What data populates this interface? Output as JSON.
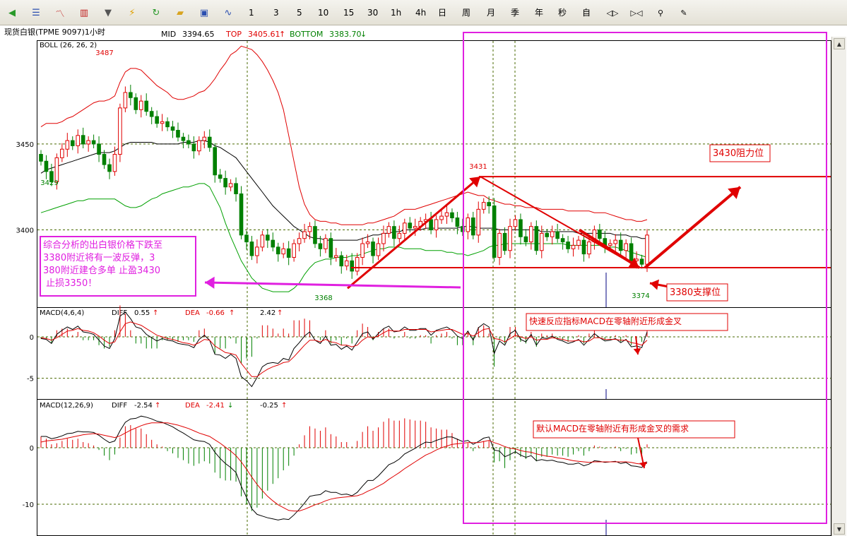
{
  "toolbar": {
    "icons": [
      {
        "name": "back-icon",
        "glyph": "◀",
        "color": "#2a9a2a"
      },
      {
        "name": "list-icon",
        "glyph": "☰",
        "color": "#2b4fb0"
      },
      {
        "name": "line-chart-icon",
        "glyph": "〽",
        "color": "#c02020"
      },
      {
        "name": "kline-icon",
        "glyph": "▥",
        "color": "#c02020"
      },
      {
        "name": "dropdown-icon",
        "glyph": "▼",
        "color": "#555555"
      },
      {
        "name": "lightning-icon",
        "glyph": "⚡",
        "color": "#e0a000"
      },
      {
        "name": "refresh-icon",
        "glyph": "↻",
        "color": "#2a9a2a"
      },
      {
        "name": "folder-icon",
        "glyph": "▰",
        "color": "#d8a420"
      },
      {
        "name": "save-icon",
        "glyph": "▣",
        "color": "#2b4fb0"
      },
      {
        "name": "wave-icon",
        "glyph": "∿",
        "color": "#2b4fb0"
      }
    ],
    "periods": [
      "1",
      "3",
      "5",
      "10",
      "15",
      "30",
      "1h",
      "4h",
      "日",
      "周",
      "月",
      "季",
      "年",
      "秒",
      "自"
    ],
    "tools": [
      {
        "name": "expand-icon",
        "glyph": "◁▷"
      },
      {
        "name": "collapse-icon",
        "glyph": "▷◁"
      },
      {
        "name": "zoom-icon",
        "glyph": "⚲"
      },
      {
        "name": "pen-icon",
        "glyph": "✎"
      }
    ]
  },
  "header": {
    "symbol": "现货白银(TPME 9097)1小时",
    "mid_label": "MID",
    "mid_value": "3394.65",
    "top_label": "TOP",
    "top_value": "3405.61",
    "bottom_label": "BOTTOM",
    "bottom_value": "3383.70",
    "up_arrow": "↑",
    "down_arrow": "↓"
  },
  "colors": {
    "up": "#e00000",
    "down": "#008000",
    "mid_line": "#000000",
    "upper_band": "#e00000",
    "lower_band": "#00a000",
    "annotation": "#e00000",
    "highlight": "#e020e0",
    "grid": "#4a6a00",
    "axis": "#000000"
  },
  "chart_data": [
    {
      "type": "candlestick",
      "indicator": "BOLL (26, 26, 2)",
      "ylim": [
        3355,
        3510
      ],
      "yticks": [
        3400,
        3450
      ],
      "labels": {
        "high": "3487",
        "start_low": "3429",
        "low": "3368",
        "swing_high": "3431",
        "last_low": "3374"
      },
      "closes": [
        3440,
        3434,
        3428,
        3442,
        3447,
        3452,
        3449,
        3455,
        3450,
        3452,
        3450,
        3444,
        3438,
        3434,
        3444,
        3471,
        3480,
        3477,
        3470,
        3475,
        3469,
        3466,
        3462,
        3463,
        3460,
        3458,
        3454,
        3452,
        3450,
        3446,
        3452,
        3454,
        3448,
        3432,
        3430,
        3425,
        3427,
        3421,
        3397,
        3393,
        3385,
        3390,
        3397,
        3394,
        3390,
        3386,
        3389,
        3384,
        3392,
        3395,
        3399,
        3402,
        3392,
        3389,
        3395,
        3384,
        3385,
        3379,
        3382,
        3376,
        3384,
        3392,
        3393,
        3385,
        3392,
        3398,
        3402,
        3395,
        3398,
        3404,
        3401,
        3402,
        3405,
        3406,
        3400,
        3406,
        3408,
        3410,
        3407,
        3402,
        3399,
        3407,
        3397,
        3412,
        3416,
        3414,
        3384,
        3398,
        3388,
        3402,
        3406,
        3396,
        3393,
        3402,
        3388,
        3398,
        3396,
        3399,
        3395,
        3393,
        3389,
        3391,
        3394,
        3386,
        3393,
        3400,
        3395,
        3391,
        3392,
        3394,
        3388,
        3392,
        3382,
        3383,
        3380,
        3397
      ],
      "upper_band": [
        3460,
        3462,
        3462,
        3462,
        3463,
        3465,
        3466,
        3468,
        3470,
        3472,
        3474,
        3475,
        3475,
        3476,
        3478,
        3486,
        3492,
        3494,
        3494,
        3493,
        3490,
        3487,
        3484,
        3482,
        3480,
        3477,
        3476,
        3476,
        3477,
        3478,
        3480,
        3481,
        3484,
        3488,
        3493,
        3497,
        3502,
        3504,
        3507,
        3506,
        3505,
        3502,
        3498,
        3493,
        3487,
        3480,
        3470,
        3455,
        3440,
        3425,
        3415,
        3409,
        3406,
        3405,
        3405,
        3404,
        3404,
        3403,
        3403,
        3403,
        3403,
        3403,
        3404,
        3404,
        3405,
        3406,
        3407,
        3408,
        3410,
        3412,
        3412,
        3412,
        3413,
        3414,
        3415,
        3416,
        3417,
        3418,
        3419,
        3420,
        3421,
        3422,
        3421,
        3420,
        3420,
        3418,
        3417,
        3416,
        3415,
        3415,
        3414,
        3414,
        3413,
        3413,
        3413,
        3412,
        3412,
        3412,
        3412,
        3412,
        3411,
        3411,
        3411,
        3411,
        3411,
        3410,
        3410,
        3410,
        3409,
        3408,
        3407,
        3406,
        3406,
        3405,
        3405,
        3406
      ],
      "mid_line": [
        3433,
        3435,
        3436,
        3437,
        3438,
        3439,
        3440,
        3441,
        3442,
        3443,
        3444,
        3445,
        3445,
        3445,
        3446,
        3448,
        3450,
        3451,
        3451,
        3451,
        3451,
        3451,
        3450,
        3450,
        3450,
        3450,
        3450,
        3451,
        3451,
        3451,
        3452,
        3452,
        3451,
        3449,
        3448,
        3446,
        3444,
        3442,
        3438,
        3434,
        3430,
        3426,
        3422,
        3418,
        3414,
        3411,
        3408,
        3405,
        3402,
        3400,
        3398,
        3396,
        3395,
        3395,
        3394,
        3394,
        3394,
        3394,
        3394,
        3394,
        3394,
        3395,
        3396,
        3397,
        3397,
        3398,
        3398,
        3399,
        3399,
        3400,
        3400,
        3400,
        3400,
        3401,
        3401,
        3401,
        3401,
        3401,
        3401,
        3401,
        3402,
        3402,
        3402,
        3401,
        3401,
        3401,
        3401,
        3400,
        3400,
        3400,
        3400,
        3400,
        3400,
        3400,
        3400,
        3399,
        3399,
        3399,
        3399,
        3399,
        3399,
        3399,
        3398,
        3398,
        3398,
        3398,
        3398,
        3398,
        3398,
        3397,
        3397,
        3397,
        3396,
        3396,
        3395,
        3395
      ],
      "lower_band": [
        3410,
        3411,
        3412,
        3413,
        3414,
        3415,
        3416,
        3417,
        3417,
        3418,
        3418,
        3418,
        3418,
        3418,
        3418,
        3416,
        3414,
        3413,
        3413,
        3414,
        3416,
        3418,
        3419,
        3421,
        3422,
        3423,
        3424,
        3425,
        3425,
        3426,
        3427,
        3427,
        3425,
        3419,
        3413,
        3404,
        3396,
        3389,
        3382,
        3377,
        3372,
        3369,
        3366,
        3365,
        3364,
        3364,
        3364,
        3364,
        3366,
        3369,
        3374,
        3378,
        3381,
        3382,
        3383,
        3383,
        3384,
        3384,
        3384,
        3385,
        3385,
        3386,
        3387,
        3388,
        3389,
        3389,
        3390,
        3390,
        3390,
        3389,
        3389,
        3389,
        3389,
        3388,
        3388,
        3388,
        3388,
        3387,
        3387,
        3386,
        3386,
        3385,
        3386,
        3387,
        3388,
        3390,
        3391,
        3391,
        3392,
        3392,
        3392,
        3392,
        3392,
        3392,
        3392,
        3392,
        3392,
        3392,
        3392,
        3392,
        3391,
        3391,
        3391,
        3391,
        3391,
        3391,
        3391,
        3390,
        3390,
        3390,
        3389,
        3388,
        3387,
        3386,
        3385,
        3384
      ]
    },
    {
      "type": "macd",
      "params": "MACD(4,6,4)",
      "diff_label": "DIFF",
      "diff_value": "0.55",
      "dea_label": "DEA",
      "dea_value": "-0.66",
      "macd_value": "2.42",
      "ylim": [
        -7.5,
        3.5
      ],
      "yticks": [
        0,
        -5
      ],
      "diff": [
        -0.2,
        -0.3,
        -0.8,
        0.3,
        0.8,
        1.2,
        0.9,
        1.3,
        0.6,
        0.5,
        0.3,
        -0.4,
        -1.1,
        -1.4,
        -0.2,
        2.5,
        3.0,
        2.2,
        1.2,
        1.0,
        0.3,
        -0.1,
        -0.5,
        -0.2,
        -0.4,
        -0.5,
        -0.8,
        -0.9,
        -1.0,
        -1.3,
        -0.3,
        0.2,
        -0.4,
        -2.1,
        -2.2,
        -2.6,
        -2.1,
        -2.6,
        -4.8,
        -5.3,
        -6.0,
        -4.9,
        -3.6,
        -3.2,
        -3.1,
        -3.2,
        -2.6,
        -2.8,
        -1.4,
        -0.7,
        0.1,
        0.6,
        -0.4,
        -0.8,
        0.1,
        -1.0,
        -0.9,
        -1.5,
        -1.1,
        -1.6,
        -0.6,
        0.4,
        0.6,
        -0.3,
        0.4,
        1.0,
        1.3,
        0.6,
        0.7,
        1.2,
        0.8,
        0.8,
        1.0,
        1.0,
        0.2,
        0.8,
        1.0,
        1.2,
        0.8,
        0.1,
        -0.2,
        0.7,
        -0.4,
        1.1,
        1.6,
        1.2,
        -2.0,
        -0.5,
        -1.0,
        0.4,
        0.8,
        -0.3,
        -0.6,
        0.3,
        -1.0,
        -0.1,
        -0.2,
        0.1,
        -0.3,
        -0.5,
        -0.8,
        -0.6,
        -0.3,
        -1.0,
        -0.3,
        0.4,
        -0.1,
        -0.5,
        -0.4,
        -0.2,
        -0.7,
        -0.3,
        -1.2,
        -1.1,
        -1.3,
        0.6
      ],
      "dea": [
        -0.1,
        -0.2,
        -0.4,
        -0.1,
        0.3,
        0.7,
        0.8,
        1.0,
        0.8,
        0.7,
        0.5,
        0.1,
        -0.4,
        -0.8,
        -0.6,
        0.6,
        1.6,
        1.8,
        1.6,
        1.4,
        1.0,
        0.6,
        0.2,
        0.0,
        -0.2,
        -0.3,
        -0.5,
        -0.7,
        -0.8,
        -1.0,
        -0.7,
        -0.3,
        -0.4,
        -1.1,
        -1.5,
        -1.9,
        -2.0,
        -2.2,
        -3.2,
        -4.0,
        -4.8,
        -4.8,
        -4.3,
        -3.9,
        -3.6,
        -3.4,
        -3.1,
        -3.0,
        -2.4,
        -1.7,
        -1.0,
        -0.4,
        -0.4,
        -0.6,
        -0.3,
        -0.6,
        -0.7,
        -1.0,
        -1.0,
        -1.2,
        -1.0,
        -0.4,
        0.0,
        -0.1,
        0.1,
        0.5,
        0.8,
        0.7,
        0.7,
        0.9,
        0.9,
        0.9,
        0.9,
        0.9,
        0.6,
        0.7,
        0.8,
        0.9,
        0.9,
        0.6,
        0.3,
        0.4,
        0.1,
        0.5,
        0.9,
        1.0,
        -0.2,
        -0.3,
        -0.6,
        -0.2,
        0.2,
        0.0,
        -0.2,
        0.0,
        -0.4,
        -0.3,
        -0.3,
        -0.1,
        -0.2,
        -0.3,
        -0.5,
        -0.5,
        -0.4,
        -0.6,
        -0.5,
        -0.1,
        -0.1,
        -0.3,
        -0.3,
        -0.3,
        -0.4,
        -0.4,
        -0.7,
        -0.8,
        -1.0,
        -0.4
      ]
    },
    {
      "type": "macd",
      "params": "MACD(12,26,9)",
      "diff_label": "DIFF",
      "diff_value": "-2.54",
      "dea_label": "DEA",
      "dea_value": "-2.41",
      "macd_value": "-0.25",
      "ylim": [
        -15.5,
        8.5
      ],
      "yticks": [
        0,
        -10
      ],
      "diff": [
        2.0,
        2.0,
        1.6,
        1.8,
        2.1,
        2.5,
        2.6,
        2.9,
        2.8,
        2.8,
        2.7,
        2.2,
        1.5,
        0.9,
        1.2,
        3.0,
        4.5,
        5.1,
        5.2,
        5.6,
        5.4,
        5.1,
        4.7,
        4.5,
        4.1,
        3.7,
        3.1,
        2.6,
        2.0,
        1.4,
        1.2,
        1.1,
        0.6,
        -0.8,
        -1.9,
        -2.8,
        -3.5,
        -4.4,
        -6.8,
        -8.8,
        -10.8,
        -11.8,
        -12.1,
        -12.4,
        -12.6,
        -12.8,
        -12.6,
        -12.7,
        -11.9,
        -10.9,
        -9.8,
        -8.6,
        -8.4,
        -8.3,
        -7.6,
        -7.9,
        -7.9,
        -8.3,
        -8.2,
        -8.5,
        -7.9,
        -6.8,
        -5.8,
        -5.8,
        -5.0,
        -4.0,
        -3.0,
        -2.6,
        -2.0,
        -1.1,
        -0.6,
        -0.1,
        0.5,
        1.0,
        0.9,
        1.3,
        1.6,
        1.9,
        1.9,
        1.5,
        1.1,
        1.3,
        0.6,
        1.1,
        1.7,
        1.9,
        -0.4,
        -0.6,
        -1.6,
        -1.2,
        -0.7,
        -1.3,
        -1.7,
        -1.4,
        -2.3,
        -2.1,
        -2.3,
        -2.2,
        -2.5,
        -2.6,
        -2.9,
        -2.9,
        -2.7,
        -3.2,
        -2.9,
        -2.3,
        -2.4,
        -2.6,
        -2.5,
        -2.4,
        -2.8,
        -2.6,
        -3.2,
        -3.3,
        -3.5,
        -2.5
      ],
      "dea": [
        1.0,
        1.2,
        1.3,
        1.4,
        1.5,
        1.7,
        1.9,
        2.1,
        2.3,
        2.4,
        2.5,
        2.4,
        2.2,
        2.0,
        1.8,
        2.1,
        2.6,
        3.1,
        3.5,
        3.9,
        4.2,
        4.4,
        4.4,
        4.4,
        4.4,
        4.2,
        4.0,
        3.7,
        3.4,
        3.0,
        2.6,
        2.3,
        2.0,
        1.4,
        0.8,
        0.1,
        -0.6,
        -1.4,
        -2.5,
        -3.8,
        -5.2,
        -6.5,
        -7.6,
        -8.6,
        -9.4,
        -10.1,
        -10.6,
        -11.1,
        -11.2,
        -11.2,
        -10.9,
        -10.5,
        -10.1,
        -9.8,
        -9.4,
        -9.1,
        -8.9,
        -8.8,
        -8.7,
        -8.6,
        -8.5,
        -8.2,
        -7.7,
        -7.3,
        -6.8,
        -6.3,
        -5.6,
        -5.0,
        -4.4,
        -3.7,
        -3.1,
        -2.5,
        -1.9,
        -1.3,
        -0.9,
        -0.4,
        0.0,
        0.3,
        0.6,
        0.7,
        0.8,
        0.9,
        0.9,
        0.9,
        1.1,
        1.3,
        0.9,
        0.6,
        0.2,
        -0.1,
        -0.2,
        -0.5,
        -0.7,
        -0.8,
        -1.1,
        -1.3,
        -1.5,
        -1.6,
        -1.8,
        -1.9,
        -2.1,
        -2.3,
        -2.4,
        -2.5,
        -2.6,
        -2.5,
        -2.5,
        -2.5,
        -2.5,
        -2.5,
        -2.5,
        -2.5,
        -2.6,
        -2.8,
        -2.9,
        -2.8
      ]
    }
  ],
  "annotations": {
    "analysis": "综合分析的出白银价格下跌至3380附近将有一波反弹，3380附近建仓多单 止盈3430 止损3350！",
    "resistance": "3430阻力位",
    "support": "3380支撑位",
    "macd_fast": "快速反应指标MACD在零轴附近形成金叉",
    "macd_default": "默认MACD在零轴附近有形成金叉的需求"
  }
}
